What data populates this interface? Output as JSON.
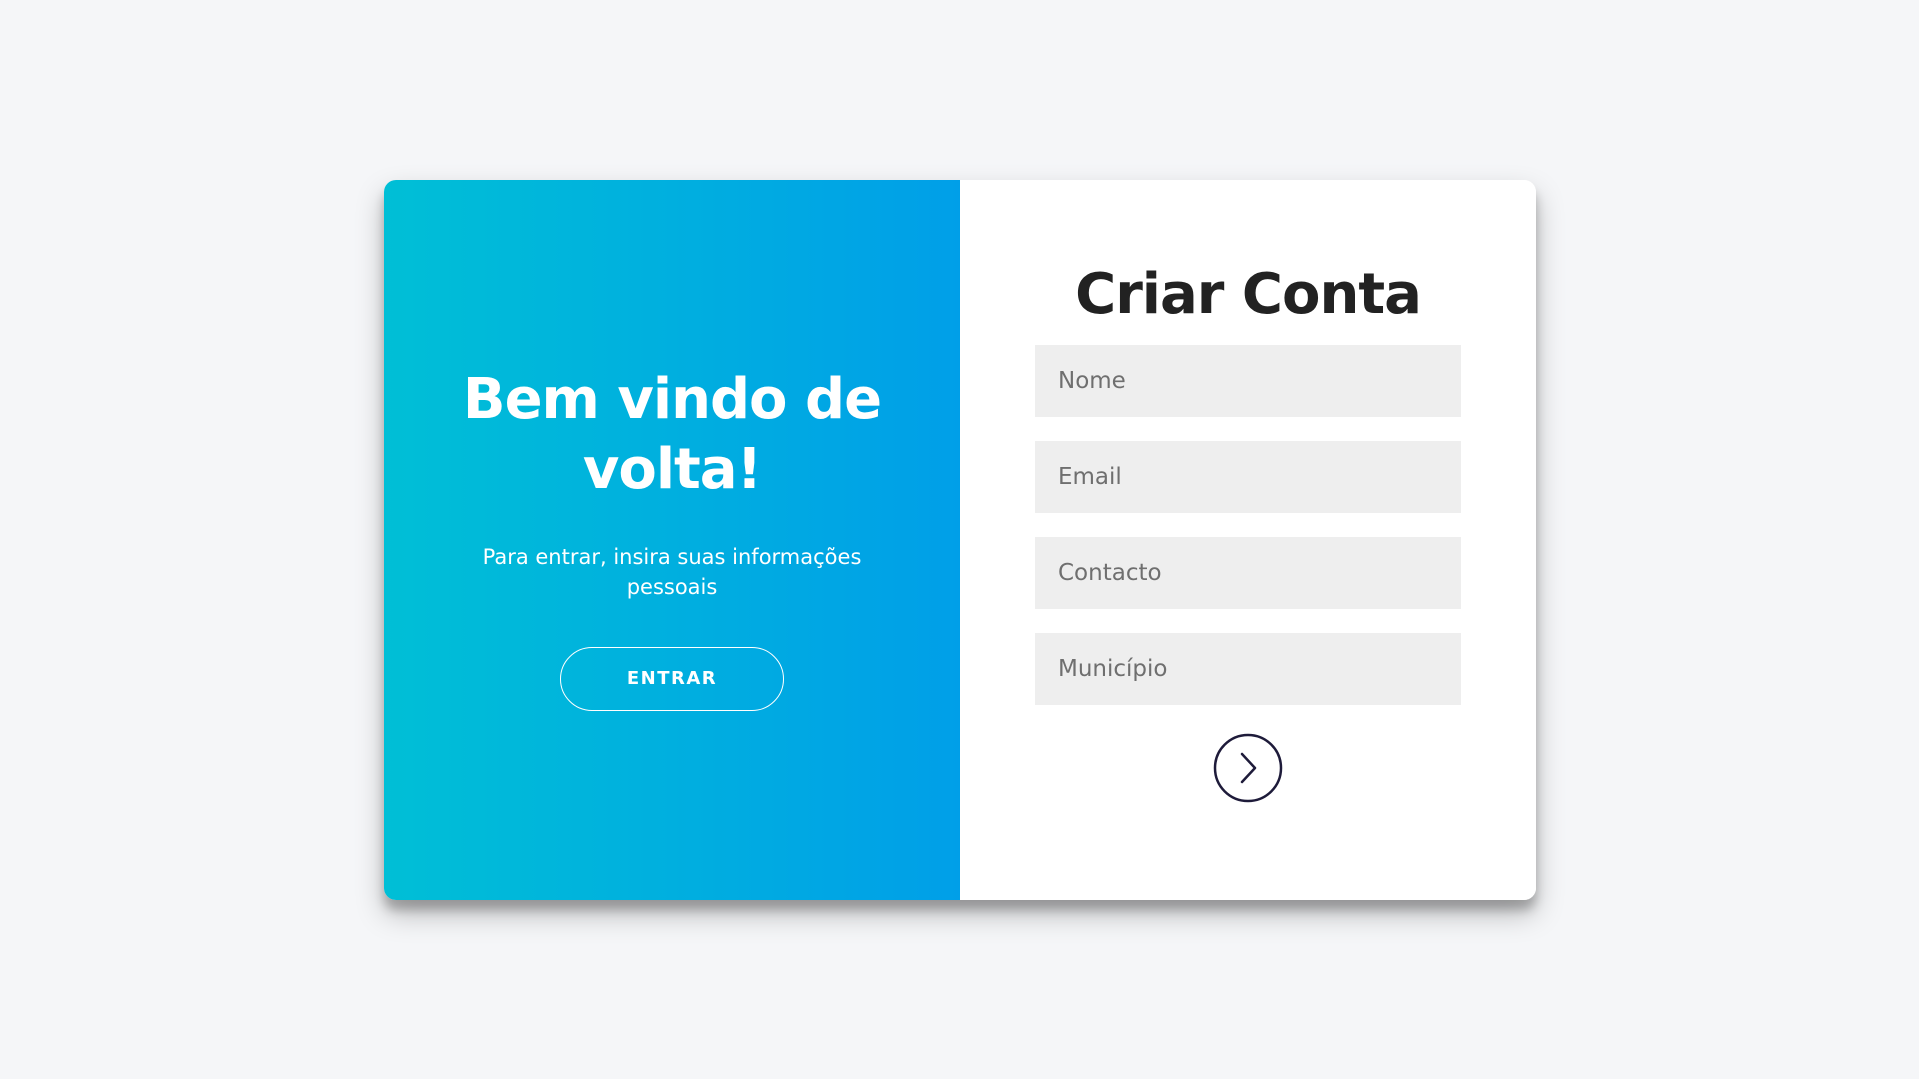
{
  "welcome": {
    "title": "Bem vindo de volta!",
    "text": "Para entrar, insira suas informações pessoais",
    "button_label": "ENTRAR"
  },
  "signup": {
    "title": "Criar Conta",
    "fields": [
      {
        "placeholder": "Nome",
        "value": ""
      },
      {
        "placeholder": "Email",
        "value": ""
      },
      {
        "placeholder": "Contacto",
        "value": ""
      },
      {
        "placeholder": "Município",
        "value": ""
      }
    ],
    "submit_icon": "chevron-right-circle-icon"
  },
  "colors": {
    "page_background": "#f5f6f8",
    "gradient_start": "#00bfd6",
    "gradient_end": "#009fe8",
    "input_background": "#eeeeee",
    "title_text": "#222222",
    "submit_icon": "#1e1b3a"
  }
}
